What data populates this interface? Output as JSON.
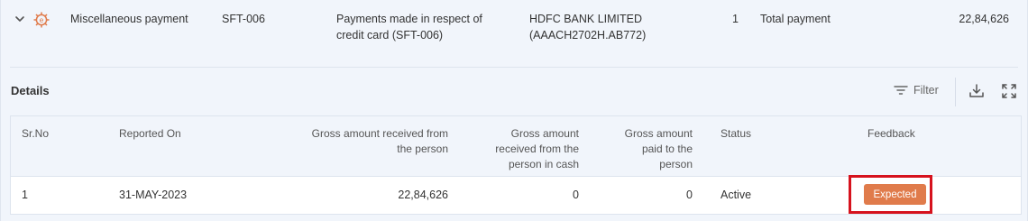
{
  "summary_row": {
    "category": "Miscellaneous payment",
    "code": "SFT-006",
    "description_line1": "Payments made in respect of",
    "description_line2": "credit card (SFT-006)",
    "bank_line1": "HDFC BANK LIMITED",
    "bank_line2": "(AAACH2702H.AB772)",
    "count": "1",
    "type": "Total payment",
    "amount": "22,84,626"
  },
  "details": {
    "title": "Details",
    "filter_label": "Filter"
  },
  "table": {
    "headers": {
      "srno": "Sr.No",
      "reported_on": "Reported On",
      "gross_received_l1": "Gross amount received from",
      "gross_received_l2": "the person",
      "gross_cash_l1": "Gross amount",
      "gross_cash_l2": "received from the",
      "gross_cash_l3": "person in cash",
      "gross_paid_l1": "Gross amount",
      "gross_paid_l2": "paid to the",
      "gross_paid_l3": "person",
      "status": "Status",
      "feedback": "Feedback"
    },
    "rows": [
      {
        "srno": "1",
        "reported_on": "31-MAY-2023",
        "gross_received": "22,84,626",
        "gross_cash": "0",
        "gross_paid": "0",
        "status": "Active",
        "feedback": "Expected"
      }
    ]
  },
  "colors": {
    "accent_orange": "#e07b4b",
    "highlight_red": "#d6121d",
    "panel_bg": "#f1f5fb"
  },
  "icons": [
    "chevron-down-icon",
    "e-gear-icon",
    "filter-icon",
    "download-icon",
    "fullscreen-icon"
  ]
}
